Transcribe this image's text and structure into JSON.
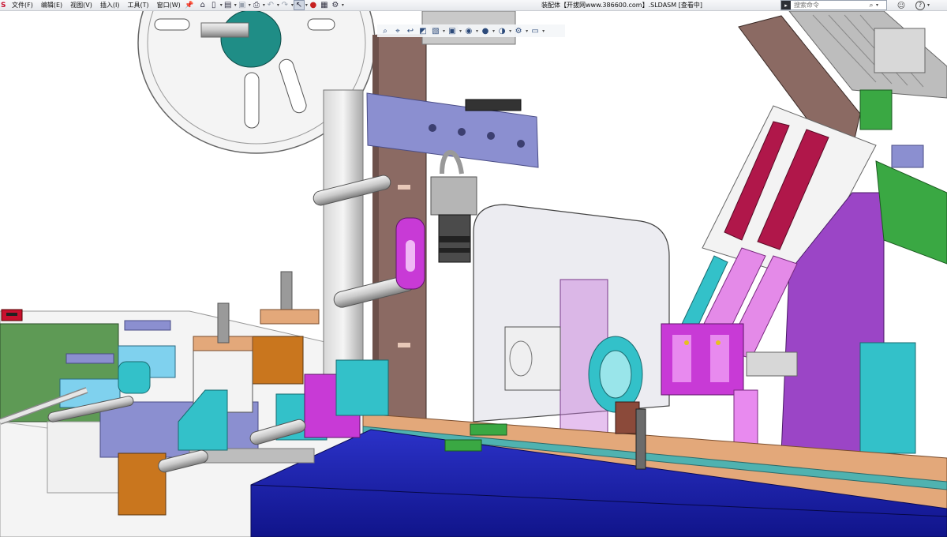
{
  "app": {
    "logo_fragment": "S",
    "title": "装配体【开拔网www.386600.com】.SLDASM [查看中]"
  },
  "menu": {
    "items": [
      {
        "label": "文件(F)"
      },
      {
        "label": "编辑(E)"
      },
      {
        "label": "视图(V)"
      },
      {
        "label": "插入(I)"
      },
      {
        "label": "工具(T)"
      },
      {
        "label": "窗口(W)"
      }
    ],
    "pin_icon": "pin-icon"
  },
  "toolbar": {
    "buttons": [
      {
        "name": "home-icon"
      },
      {
        "name": "new-document-icon"
      },
      {
        "name": "open-icon"
      },
      {
        "name": "save-icon"
      },
      {
        "name": "print-icon"
      },
      {
        "name": "undo-icon"
      },
      {
        "name": "redo-icon"
      },
      {
        "name": "select-pointer-icon"
      },
      {
        "name": "traffic-light-icon"
      },
      {
        "name": "file-properties-icon"
      },
      {
        "name": "options-gear-icon"
      }
    ]
  },
  "search": {
    "placeholder": "搜索命令"
  },
  "heads_up_toolbar": {
    "buttons": [
      "zoom-to-fit-icon",
      "zoom-area-icon",
      "previous-view-icon",
      "section-view-icon",
      "view-orientation-icon",
      "display-style-icon",
      "hide-show-icon",
      "edit-appearance-icon",
      "apply-scene-icon",
      "view-settings-icon",
      "display-icon"
    ]
  },
  "colors": {
    "toolbar_bg": "#e6e8ec",
    "base_plate_blue": "#1a1fb0",
    "tan_plate": "#e3a87a",
    "magenta": "#c83ad6",
    "lavender": "#8b8fd0",
    "teal": "#33c1c9",
    "green_pcb": "#5e9a55",
    "crimson": "#b0174a",
    "brown_column": "#8b6a63",
    "orange_block": "#c9761e"
  }
}
